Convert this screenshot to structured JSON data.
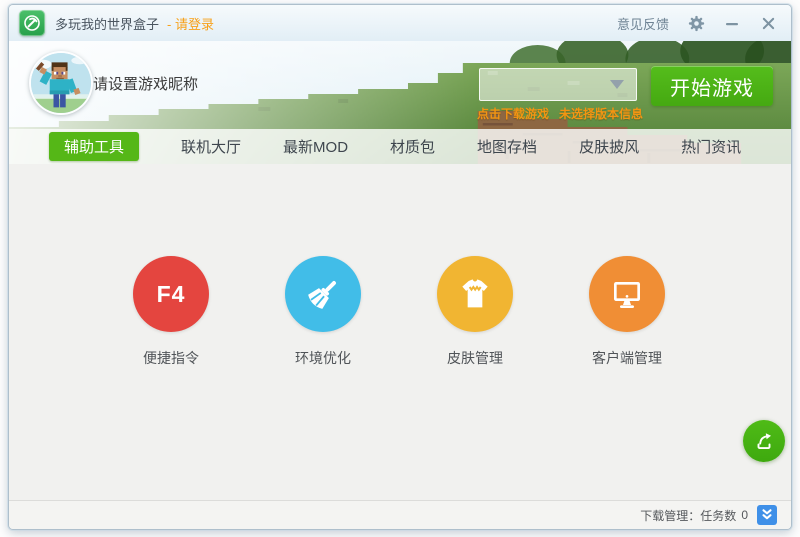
{
  "titlebar": {
    "app_title": "多玩我的世界盒子",
    "login_link": "- 请登录",
    "feedback": "意见反馈"
  },
  "header": {
    "nickname": "请设置游戏昵称",
    "version_select_value": "",
    "download_hint": "点击下载游戏",
    "version_hint": "未选择版本信息",
    "start_button": "开始游戏"
  },
  "nav": {
    "tabs": [
      {
        "label": "辅助工具",
        "active": true
      },
      {
        "label": "联机大厅",
        "active": false
      },
      {
        "label": "最新MOD",
        "active": false
      },
      {
        "label": "材质包",
        "active": false
      },
      {
        "label": "地图存档",
        "active": false
      },
      {
        "label": "皮肤披风",
        "active": false
      },
      {
        "label": "热门资讯",
        "active": false
      }
    ]
  },
  "tools": [
    {
      "label": "便捷指令",
      "badge": "F4",
      "color": "#e4453f",
      "icon": "f4-badge"
    },
    {
      "label": "环境优化",
      "badge": "",
      "color": "#41bde8",
      "icon": "brush-icon"
    },
    {
      "label": "皮肤管理",
      "badge": "",
      "color": "#f1b532",
      "icon": "tshirt-icon"
    },
    {
      "label": "客户端管理",
      "badge": "",
      "color": "#f08e35",
      "icon": "monitor-icon"
    }
  ],
  "statusbar": {
    "download_label": "下载管理：",
    "tasks_label": "任务数",
    "tasks_count": "0"
  },
  "colors": {
    "accent_green": "#55b717",
    "start_button_green": "#4bb315",
    "orange_text": "#f39512",
    "titlebar_bg": "#e9f2f8",
    "content_bg": "#f1f1ef",
    "download_toggle_blue": "#3f90e8"
  }
}
